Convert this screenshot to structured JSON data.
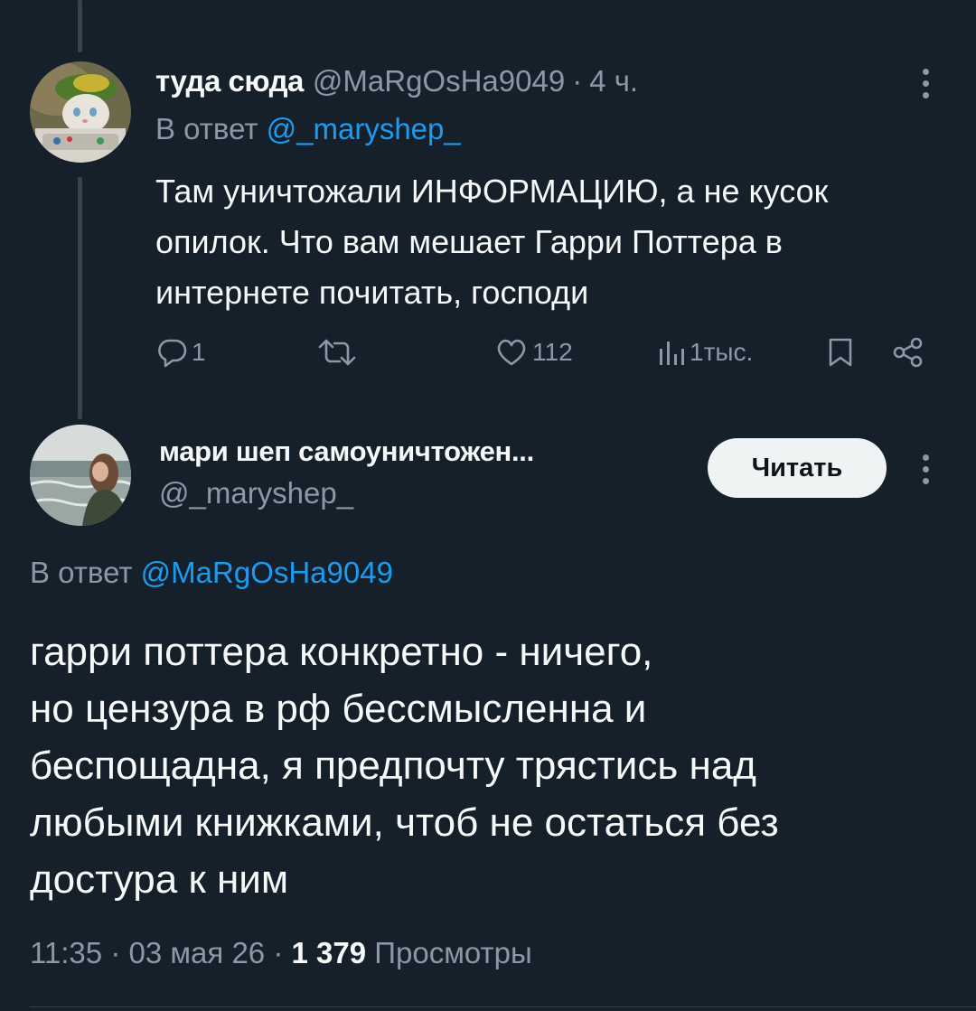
{
  "reply_tweet": {
    "display_name": "туда сюда",
    "handle": "@MaRgOsHa9049",
    "separator": "·",
    "time": "4 ч.",
    "reply_prefix": "В ответ",
    "reply_to": "@_maryshep_",
    "text": "Там уничтожали ИНФОРМАЦИЮ, а не кусок опилок. Что вам мешает Гарри Поттера в интернете почитать, господи",
    "actions": {
      "replies": "1",
      "retweets": "",
      "likes": "112",
      "views": "1тыс."
    }
  },
  "main_tweet": {
    "display_name": "мари шеп самоуничтожен...",
    "handle": "@_maryshep_",
    "follow_label": "Читать",
    "reply_prefix": "В ответ",
    "reply_to": "@MaRgOsHa9049",
    "text_lines": [
      "гарри поттера конкретно - ничего,",
      "но цензура в рф бессмысленна и",
      "беспощадна, я предпочту трястись над",
      "любыми книжками, чтоб не остаться без",
      "достура к ним"
    ],
    "time": "11:35",
    "date": "03 мая 26",
    "separator": "·",
    "views_count": "1 379",
    "views_label": "Просмотры"
  },
  "colors": {
    "background": "#15202b",
    "text_primary": "#f7f9f9",
    "text_secondary": "#8b98a5",
    "link": "#1d9bf0",
    "button_bg": "#eff3f4",
    "border": "#38444d"
  }
}
